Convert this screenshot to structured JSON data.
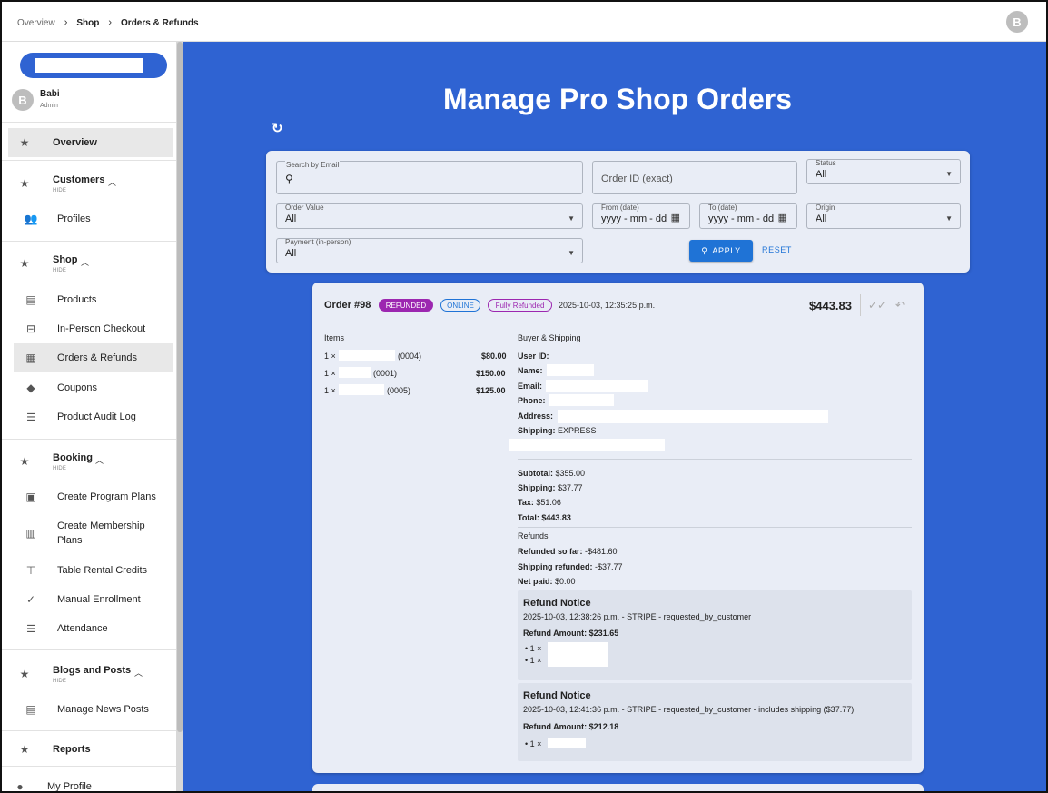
{
  "breadcrumb": {
    "item1": "Overview",
    "item2": "Shop",
    "item3": "Orders & Refunds",
    "sep": ">"
  },
  "top_avatar": "B",
  "user": {
    "initial": "B",
    "name": "Babi",
    "role": "Admin"
  },
  "sidebar": {
    "overview": "Overview",
    "customers": "Customers",
    "customers_hide": "HIDE",
    "profiles": "Profiles",
    "shop": "Shop",
    "shop_hide": "HIDE",
    "products": "Products",
    "in_person": "In-Person Checkout",
    "orders_refunds": "Orders & Refunds",
    "coupons": "Coupons",
    "audit_log": "Product Audit Log",
    "booking": "Booking",
    "booking_hide": "HIDE",
    "program_plans": "Create Program Plans",
    "membership_plans_1": "Create Membership",
    "membership_plans_2": "Plans",
    "table_rental": "Table Rental Credits",
    "manual_enrollment": "Manual Enrollment",
    "attendance": "Attendance",
    "blogs": "Blogs and Posts",
    "blogs_hide": "HIDE",
    "manage_news": "Manage News Posts",
    "reports": "Reports",
    "my_profile": "My Profile"
  },
  "page_title": "Manage Pro Shop Orders",
  "filters": {
    "search_label": "Search by Email",
    "order_id_placeholder": "Order ID (exact)",
    "status_label": "Status",
    "status_value": "All",
    "order_value_label": "Order Value",
    "order_value_value": "All",
    "from_label": "From (date)",
    "from_value": "yyyy - mm - dd",
    "to_label": "To (date)",
    "to_value": "yyyy - mm - dd",
    "origin_label": "Origin",
    "origin_value": "All",
    "payment_label": "Payment (in-person)",
    "payment_value": "All",
    "apply": "APPLY",
    "reset": "RESET"
  },
  "order": {
    "number": "Order #98",
    "badge_refunded": "REFUNDED",
    "badge_online": "ONLINE",
    "badge_full": "Fully Refunded",
    "date": "2025-10-03, 12:35:25 p.m.",
    "total": "$443.83",
    "items_title": "Items",
    "items": [
      {
        "qty": "1 ×",
        "code": "(0004)",
        "price": "$80.00"
      },
      {
        "qty": "1 ×",
        "code": "(0001)",
        "price": "$150.00"
      },
      {
        "qty": "1 ×",
        "code": "(0005)",
        "price": "$125.00"
      }
    ],
    "buyer_title": "Buyer & Shipping",
    "user_id_label": "User ID:",
    "name_label": "Name:",
    "email_label": "Email:",
    "phone_label": "Phone:",
    "address_label": "Address:",
    "shipping_label": "Shipping:",
    "shipping_value": "EXPRESS",
    "subtotal_label": "Subtotal:",
    "subtotal_value": "$355.00",
    "ship_label": "Shipping:",
    "ship_value": "$37.77",
    "tax_label": "Tax:",
    "tax_value": "$51.06",
    "total_label": "Total:",
    "total_value": "$443.83",
    "refunds_title": "Refunds",
    "refunded_label": "Refunded so far:",
    "refunded_value": "-$481.60",
    "ship_refunded_label": "Shipping refunded:",
    "ship_refunded_value": "-$37.77",
    "net_label": "Net paid:",
    "net_value": "$0.00",
    "notices": [
      {
        "title": "Refund Notice",
        "meta": "2025-10-03, 12:38:26 p.m. - STRIPE - requested_by_customer",
        "amount_label": "Refund Amount:",
        "amount": "$231.65",
        "lines": [
          "1 ×",
          "1 ×"
        ]
      },
      {
        "title": "Refund Notice",
        "meta": "2025-10-03, 12:41:36 p.m. - STRIPE - requested_by_customer - includes shipping ($37.77)",
        "amount_label": "Refund Amount:",
        "amount": "$212.18",
        "lines": [
          "1 ×"
        ]
      }
    ]
  },
  "colors": {
    "primary": "#2f63d2",
    "button": "#1f73d6",
    "refunded": "#9c27b0"
  }
}
